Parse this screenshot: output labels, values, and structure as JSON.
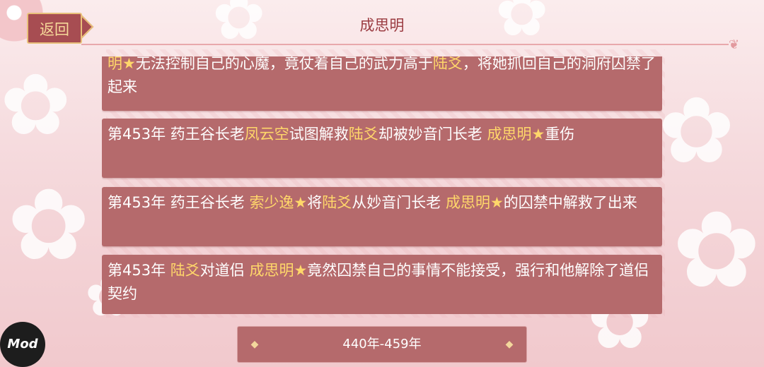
{
  "header": {
    "title": "成思明",
    "back_label": "返回"
  },
  "events": [
    {
      "segments": [
        {
          "text": "明★",
          "hl": true
        },
        {
          "text": "无法控制自己的心魔，竟仗着自己的武力高于",
          "hl": false
        },
        {
          "text": "陆爻",
          "hl": true
        },
        {
          "text": "，将她抓回自己的洞府囚禁了起来",
          "hl": false
        }
      ]
    },
    {
      "segments": [
        {
          "text": "第453年 药王谷长老",
          "hl": false
        },
        {
          "text": "凤云空",
          "hl": true
        },
        {
          "text": "试图解救",
          "hl": false
        },
        {
          "text": "陆爻",
          "hl": true
        },
        {
          "text": "却被妙音门长老 ",
          "hl": false
        },
        {
          "text": "成思明★",
          "hl": true
        },
        {
          "text": "重伤",
          "hl": false
        }
      ]
    },
    {
      "segments": [
        {
          "text": "第453年 药王谷长老 ",
          "hl": false
        },
        {
          "text": "索少逸★",
          "hl": true
        },
        {
          "text": "将",
          "hl": false
        },
        {
          "text": "陆爻",
          "hl": true
        },
        {
          "text": "从妙音门长老 ",
          "hl": false
        },
        {
          "text": "成思明★",
          "hl": true
        },
        {
          "text": "的囚禁中解救了出来",
          "hl": false
        }
      ]
    },
    {
      "segments": [
        {
          "text": "第453年 ",
          "hl": false
        },
        {
          "text": "陆爻",
          "hl": true
        },
        {
          "text": "对道侣 ",
          "hl": false
        },
        {
          "text": "成思明★",
          "hl": true
        },
        {
          "text": "竟然囚禁自己的事情不能接受，强行和他解除了道侣契约",
          "hl": false
        }
      ]
    }
  ],
  "range": {
    "label": "440年-459年"
  },
  "badge": {
    "label": "Mod"
  },
  "colors": {
    "card": "#b56a6c",
    "highlight": "#ffd76a",
    "title": "#9b3c42"
  }
}
